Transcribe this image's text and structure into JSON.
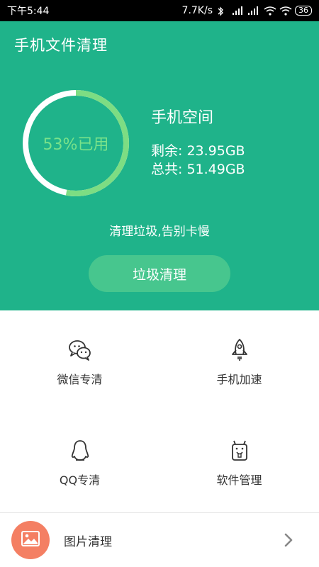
{
  "status_bar": {
    "time": "下午5:44",
    "speed": "7.7K/s",
    "battery": "36"
  },
  "header": {
    "title": "手机文件清理",
    "usage_percent": 53,
    "usage_label": "53%已用",
    "storage_title": "手机空间",
    "remaining": "剩余: 23.95GB",
    "total": "总共: 51.49GB",
    "slogan": "清理垃圾,告别卡慢",
    "clean_button": "垃圾清理"
  },
  "grid": {
    "items": [
      {
        "label": "微信专清",
        "icon": "wechat-icon"
      },
      {
        "label": "手机加速",
        "icon": "rocket-icon"
      },
      {
        "label": "QQ专清",
        "icon": "qq-penguin-icon"
      },
      {
        "label": "软件管理",
        "icon": "android-app-icon"
      }
    ]
  },
  "photo_row": {
    "label": "图片清理",
    "icon": "image-icon"
  },
  "colors": {
    "header_bg": "#1fb38a",
    "ring_used": "#7ddd83",
    "ring_free": "#ffffff",
    "button_bg": "#47c68e",
    "photo_icon_bg": "#f47f63"
  }
}
